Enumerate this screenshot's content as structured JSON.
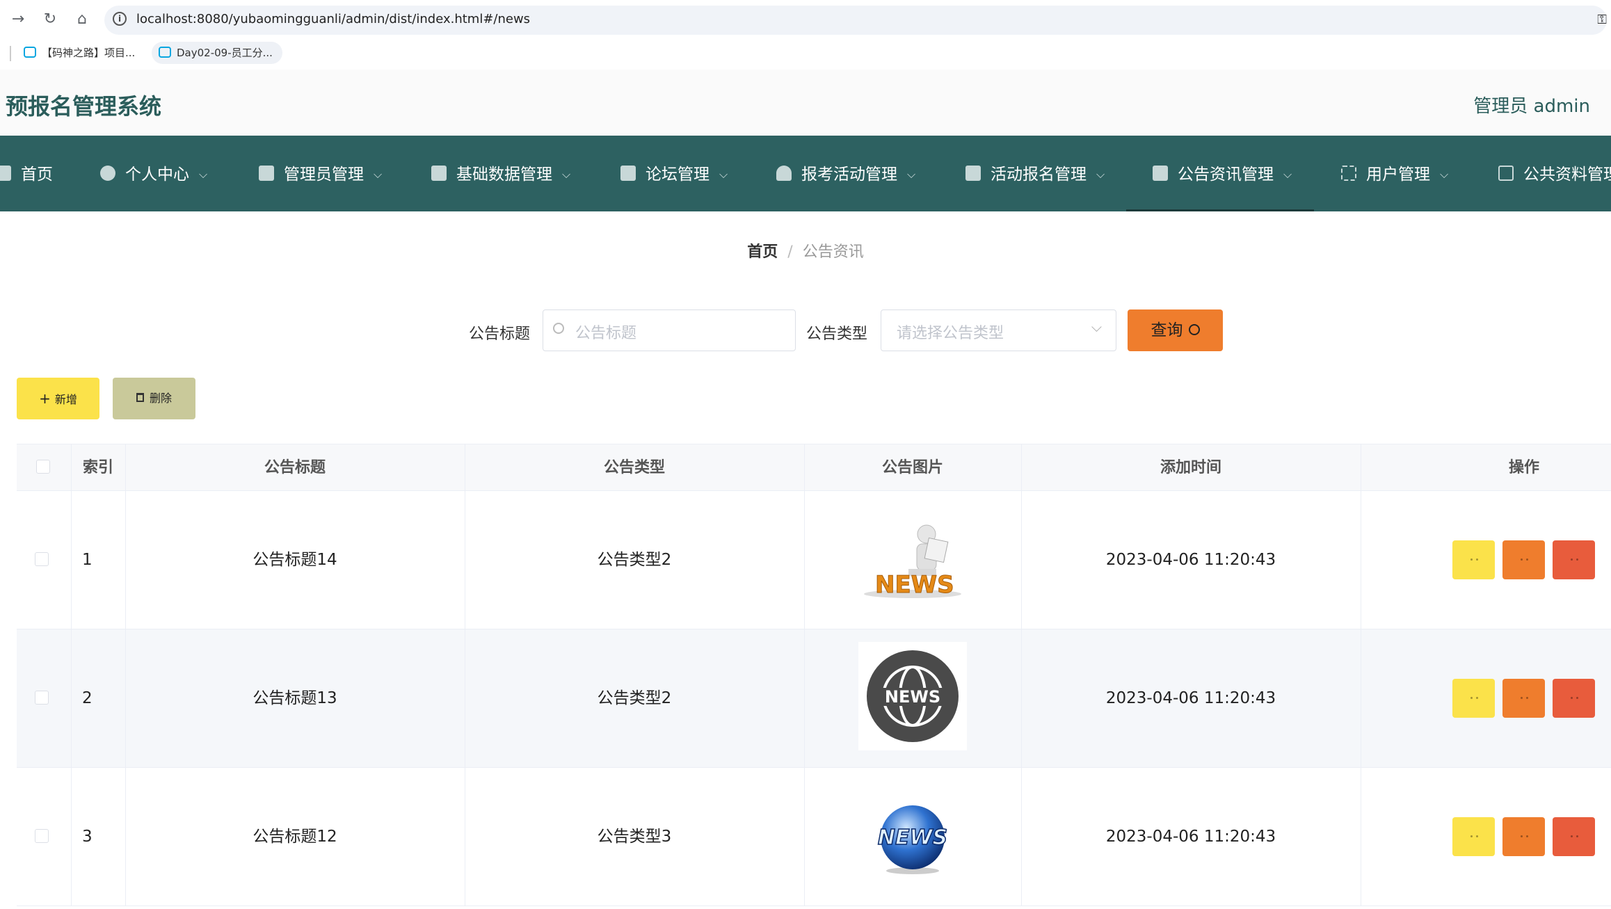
{
  "browser": {
    "url": "localhost:8080/yubaomingguanli/admin/dist/index.html#/news",
    "bookmarks": [
      "【码神之路】项目...",
      "Day02-09-员工分..."
    ]
  },
  "header": {
    "title": "预报名管理系统",
    "user": "管理员 admin"
  },
  "nav": {
    "items": [
      "首页",
      "个人中心",
      "管理员管理",
      "基础数据管理",
      "论坛管理",
      "报考活动管理",
      "活动报名管理",
      "公告资讯管理",
      "用户管理",
      "公共资料管理"
    ],
    "active_index": 7
  },
  "breadcrumb": {
    "home": "首页",
    "separator": "/",
    "current": "公告资讯"
  },
  "search": {
    "title_label": "公告标题",
    "title_placeholder": "公告标题",
    "type_label": "公告类型",
    "type_placeholder": "请选择公告类型",
    "query_button": "查询"
  },
  "toolbar": {
    "add": "新增",
    "delete": "删除"
  },
  "table": {
    "columns": [
      "索引",
      "公告标题",
      "公告类型",
      "公告图片",
      "添加时间",
      "操作"
    ],
    "rows": [
      {
        "index": "1",
        "title": "公告标题14",
        "type": "公告类型2",
        "image_label": "NEWS",
        "time": "2023-04-06 11:20:43"
      },
      {
        "index": "2",
        "title": "公告标题13",
        "type": "公告类型2",
        "image_label": "NEWS",
        "time": "2023-04-06 11:20:43"
      },
      {
        "index": "3",
        "title": "公告标题12",
        "type": "公告类型3",
        "image_label": "NEWS",
        "time": "2023-04-06 11:20:43"
      }
    ]
  },
  "colors": {
    "nav_bg": "#2d6161",
    "title": "#2b5d5b",
    "query": "#ef7d2d",
    "add": "#fbe24a",
    "delete": "#c9c99a",
    "action_red": "#e85c3c"
  }
}
